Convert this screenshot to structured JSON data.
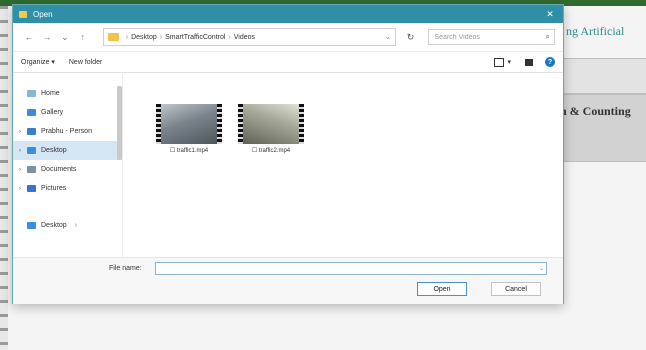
{
  "background_app": {
    "heading_partial": "ng Artificial",
    "heading_partial_2": "n & Counting"
  },
  "dialog": {
    "title": "Open",
    "close_glyph": "✕"
  },
  "nav": {
    "back": "←",
    "forward": "→",
    "up": "↑",
    "breadcrumb": [
      "Desktop",
      "SmartTrafficControl",
      "Videos"
    ],
    "search_placeholder": "Search Videos"
  },
  "commands": {
    "organize": "Organize ▾",
    "new_folder": "New folder"
  },
  "sidebar": {
    "items": [
      {
        "label": "Home",
        "icon": "home-icon"
      },
      {
        "label": "Gallery",
        "icon": "gallery-icon"
      },
      {
        "label": "Prabhu - Person",
        "icon": "user-folder-icon"
      },
      {
        "label": "Desktop",
        "icon": "desktop-icon",
        "selected": true
      },
      {
        "label": "Documents",
        "icon": "documents-icon"
      },
      {
        "label": "Pictures",
        "icon": "pictures-icon"
      },
      {
        "label": "Desktop",
        "icon": "desktop-icon"
      }
    ]
  },
  "files": [
    {
      "name": "traffic1.mp4",
      "icon": "video-file-icon"
    },
    {
      "name": "traffic2.mp4",
      "icon": "video-file-icon"
    }
  ],
  "footer": {
    "file_name_label": "File name:",
    "file_name_value": "",
    "open_label": "Open",
    "cancel_label": "Cancel"
  },
  "colors": {
    "titlebar": "#2f8fa6",
    "selection": "#d5e6f5",
    "accent_teal": "#2d8a8a"
  }
}
